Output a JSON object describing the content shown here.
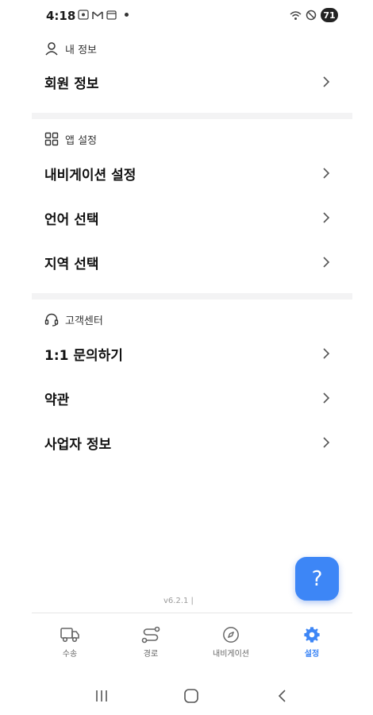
{
  "status_bar": {
    "time": "4:18",
    "battery": "71"
  },
  "sections": {
    "my_info": {
      "header": "내 정보",
      "icon": "person-icon",
      "items": [
        {
          "label": "회원 정보"
        }
      ]
    },
    "app_settings": {
      "header": "앱 설정",
      "icon": "grid-icon",
      "items": [
        {
          "label": "내비게이션 설정"
        },
        {
          "label": "언어 선택"
        },
        {
          "label": "지역 선택"
        }
      ]
    },
    "customer_center": {
      "header": "고객센터",
      "icon": "headset-icon",
      "items": [
        {
          "label": "1:1 문의하기"
        },
        {
          "label": "약관"
        },
        {
          "label": "사업자 정보"
        }
      ]
    }
  },
  "fab": {
    "label": "?",
    "icon": "help-icon"
  },
  "version": "v6.2.1 |",
  "tab_bar": {
    "active_color": "#3d86f6",
    "tabs": [
      {
        "label": "수송",
        "icon": "truck-icon"
      },
      {
        "label": "경로",
        "icon": "route-icon"
      },
      {
        "label": "내비게이션",
        "icon": "compass-icon"
      },
      {
        "label": "설정",
        "icon": "gear-icon",
        "active": true
      }
    ]
  },
  "colors": {
    "accent": "#3d86f6",
    "divider": "#f3f3f4"
  }
}
